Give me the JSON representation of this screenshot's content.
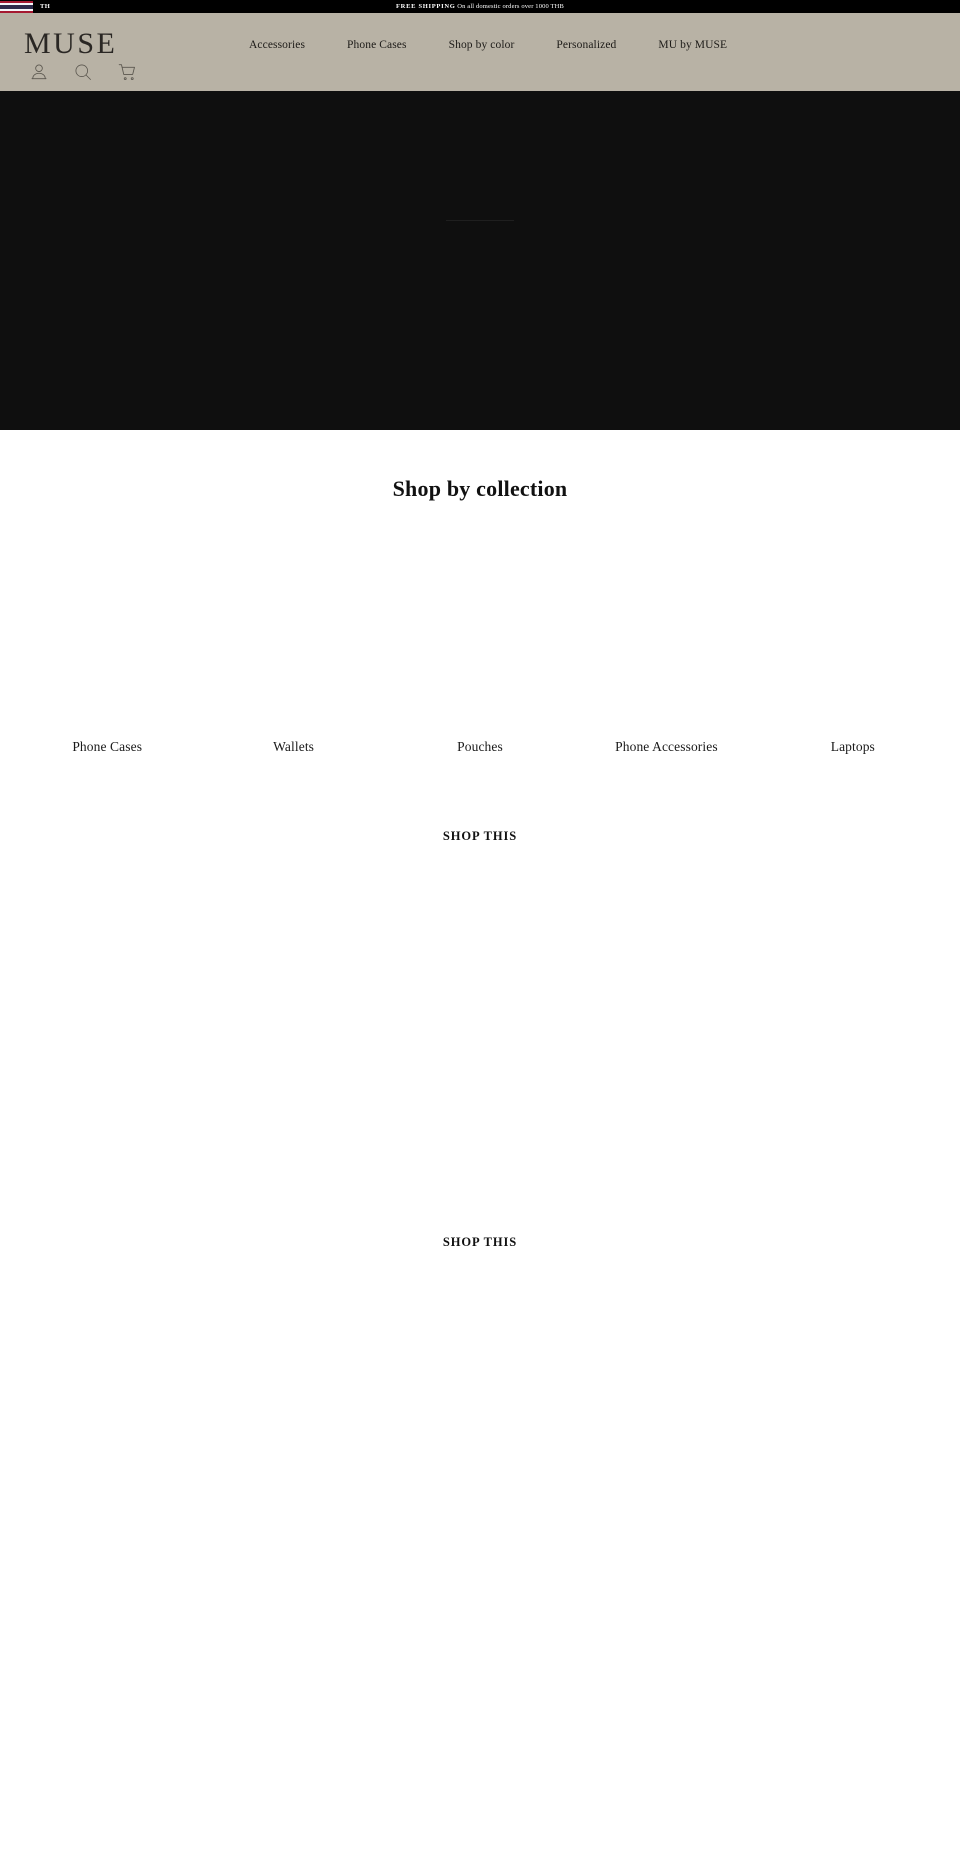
{
  "announcement": {
    "locale_code": "TH",
    "flag_name": "thailand-flag",
    "message_strong": "FREE SHIPPING",
    "message_rest": "On all domestic orders over 1000 THB"
  },
  "header": {
    "brand": "MUSE",
    "nav": [
      {
        "label": "Accessories"
      },
      {
        "label": "Phone Cases"
      },
      {
        "label": "Shop by color"
      },
      {
        "label": "Personalized"
      },
      {
        "label": "MU by MUSE"
      }
    ],
    "icons": [
      {
        "name": "account-icon",
        "title": "Account"
      },
      {
        "name": "search-icon",
        "title": "Search"
      },
      {
        "name": "cart-icon",
        "title": "Cart"
      }
    ]
  },
  "hero": {
    "background_color": "#0f0f0f"
  },
  "collections": {
    "title": "Shop by collection",
    "items": [
      {
        "label": "Phone Cases"
      },
      {
        "label": "Wallets"
      },
      {
        "label": "Pouches"
      },
      {
        "label": "Phone Accessories"
      },
      {
        "label": "Laptops"
      }
    ]
  },
  "lookbooks": [
    {
      "cta": "SHOP THIS"
    },
    {
      "cta": "SHOP THIS"
    }
  ],
  "colors": {
    "header_background": "#b8b2a5",
    "announcement_background": "#000000",
    "hero_background": "#0f0f0f",
    "text_primary": "#111111"
  }
}
